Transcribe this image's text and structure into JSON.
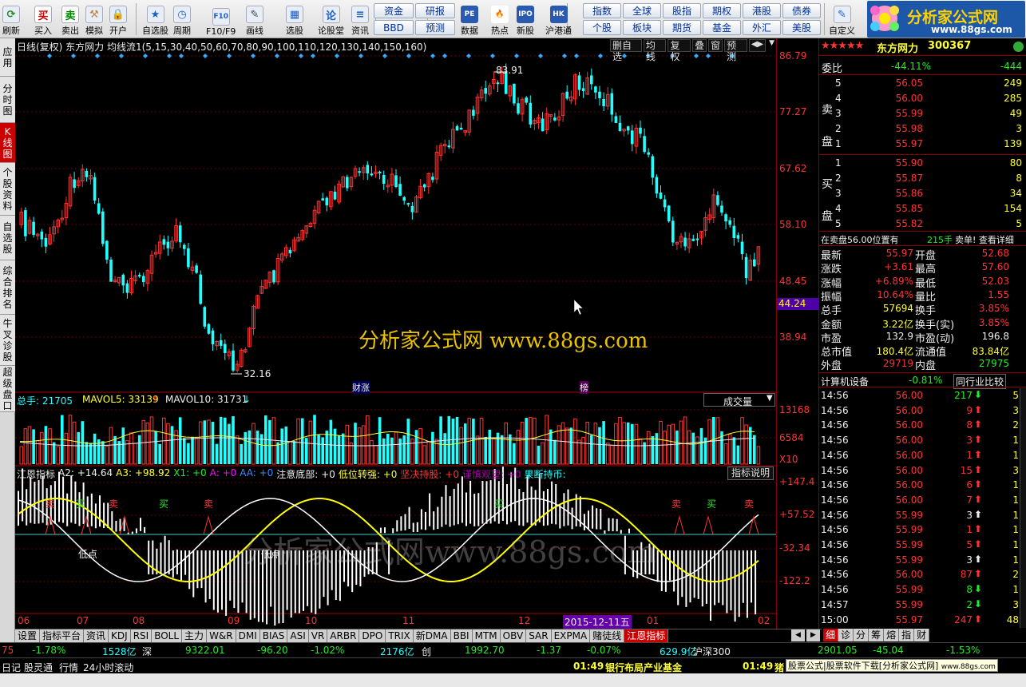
{
  "toolbar": {
    "items": [
      {
        "label": "刷新",
        "icon": "refresh-icon"
      },
      {
        "label": "买入",
        "icon": "buy-icon"
      },
      {
        "label": "卖出",
        "icon": "sell-icon"
      },
      {
        "label": "模拟",
        "icon": "gavel-icon"
      },
      {
        "label": "开户",
        "icon": "lock-icon"
      },
      {
        "label": "自选股",
        "icon": "star-icon"
      },
      {
        "label": "周期",
        "icon": "clock-icon"
      },
      {
        "label": "F10/F9",
        "icon": "f10-icon"
      },
      {
        "label": "画线",
        "icon": "pen-icon"
      },
      {
        "label": "选股",
        "icon": "screen-icon"
      },
      {
        "label": "论股堂",
        "icon": "discuss-icon"
      },
      {
        "label": "资讯",
        "icon": "news-icon"
      }
    ],
    "btn_grid": [
      [
        "资金",
        "研报"
      ],
      [
        "BBD",
        "预测"
      ]
    ],
    "items2": [
      {
        "label": "数据",
        "icon": "pe-icon"
      },
      {
        "label": "热点",
        "icon": "fire-icon"
      },
      {
        "label": "新股",
        "icon": "ipo-icon"
      },
      {
        "label": "沪港通",
        "icon": "hk-icon"
      }
    ],
    "btn_grid2": [
      [
        "指数",
        "全球",
        "股指",
        "期权",
        "港股",
        "债券"
      ],
      [
        "个股",
        "板块",
        "期货",
        "基金",
        "外汇",
        "美股"
      ]
    ],
    "custom": "自定义",
    "logo_text": "分析家公式网",
    "logo_url": "www.88gs.com"
  },
  "left_tabs": [
    "应用",
    "分时图",
    "K线图",
    "个股资料",
    "自选股",
    "综合排名",
    "牛叉诊股",
    "超级盘口"
  ],
  "chart": {
    "header": "日线(复权) 东方网力 均线流1(5,15,30,40,50,60,70,80,90,100,110,120,130,140,150,160)",
    "header_btns": [
      "删自选",
      "均线",
      "复权",
      "叠",
      "窗",
      "预测"
    ],
    "high_label": "83.91",
    "low_label": "32.16",
    "mark1": "财涨",
    "mark2": "榜",
    "watermark": "分析家公式网 www.88gs.com",
    "watermark2": "分析家公式网www.88gs.com",
    "vol_header": {
      "a": "总手: 21705",
      "b": "MAVOL5: 33139",
      "c": "MAVOL10: 31731"
    },
    "vol_select": "成交量",
    "ind_header": {
      "a": "江恩指标",
      "b": "A2: +14.64",
      "c": "A3: +98.92",
      "d": "X1: +0",
      "e": "A: +0",
      "f": "AA: +0",
      "g": "注意底部: +0",
      "h": "低位转强: +0",
      "i": "坚决持股: +0",
      "j": "谨慎观望: +0",
      "k": "果断持币:"
    },
    "ind_btn": "指标说明",
    "buy": "买",
    "sell": "卖",
    "low_pt": "低点",
    "dates": [
      "06",
      "07",
      "08",
      "09",
      "10",
      "11",
      "12",
      "01",
      "02"
    ],
    "date_hl": "2015-12-11五"
  },
  "axis": {
    "price": [
      "86.79",
      "77.27",
      "67.62",
      "58.10",
      "48.45",
      "38.94"
    ],
    "cur": "44.24",
    "vol": [
      "13168",
      "6584",
      "X10"
    ],
    "ind": [
      "+147.4",
      "+57.52",
      "-32.34",
      "-122.2"
    ]
  },
  "quote": {
    "name": "东方网力",
    "code": "300367",
    "weibi_label": "委比",
    "weibi_pct": "-44.11%",
    "weibi_val": "-444",
    "sell_label": "卖盘",
    "buy_label": "买盘",
    "asks": [
      [
        "5",
        "56.05",
        "249"
      ],
      [
        "4",
        "56.00",
        "285"
      ],
      [
        "3",
        "55.99",
        "49"
      ],
      [
        "2",
        "55.98",
        "3"
      ],
      [
        "1",
        "55.97",
        "139"
      ]
    ],
    "bids": [
      [
        "1",
        "55.90",
        "80"
      ],
      [
        "2",
        "55.87",
        "8"
      ],
      [
        "3",
        "55.86",
        "34"
      ],
      [
        "4",
        "55.85",
        "154"
      ],
      [
        "5",
        "55.82",
        "5"
      ]
    ],
    "info": {
      "a": "在卖盘56.00位置有",
      "b": "215手",
      "c": "卖单! 查看详细"
    },
    "stats": [
      [
        "最新",
        "55.97",
        "开盘",
        "52.68"
      ],
      [
        "涨跌",
        "+3.61",
        "最高",
        "57.60"
      ],
      [
        "涨幅",
        "+6.89%",
        "最低",
        "52.03"
      ],
      [
        "振幅",
        "10.64%",
        "量比",
        "1.55"
      ],
      [
        "总手",
        "57694",
        "换手",
        "3.85%"
      ],
      [
        "金额",
        "3.22亿",
        "换手(实)",
        "3.85%"
      ],
      [
        "市盈",
        "132.9",
        "市盈(动)",
        "196.8"
      ],
      [
        "总市值",
        "180.4亿",
        "流通值",
        "83.84亿"
      ],
      [
        "外盘",
        "29719",
        "内盘",
        "27975"
      ]
    ],
    "industry": "计算机设备",
    "industry_pct": "-0.81%",
    "compare": "同行业比较",
    "ticks": [
      [
        "14:56",
        "56.00",
        "217",
        "5"
      ],
      [
        "14:56",
        "56.00",
        "9",
        "3"
      ],
      [
        "14:56",
        "56.00",
        "8",
        "2"
      ],
      [
        "14:56",
        "56.00",
        "3",
        "1"
      ],
      [
        "14:56",
        "56.00",
        "1",
        "1"
      ],
      [
        "14:56",
        "56.00",
        "15",
        "3"
      ],
      [
        "14:56",
        "56.00",
        "6",
        "1"
      ],
      [
        "14:56",
        "56.00",
        "7",
        "1"
      ],
      [
        "14:56",
        "55.99",
        "3",
        "1"
      ],
      [
        "14:56",
        "55.99",
        "1",
        "1"
      ],
      [
        "14:56",
        "55.99",
        "5",
        "1"
      ],
      [
        "14:56",
        "55.99",
        "3",
        "1"
      ],
      [
        "14:56",
        "56.00",
        "87",
        "2"
      ],
      [
        "14:56",
        "55.99",
        "8",
        "1"
      ],
      [
        "14:57",
        "55.99",
        "2",
        "3"
      ],
      [
        "15:00",
        "55.97",
        "247",
        "48"
      ]
    ]
  },
  "ind_tabs": [
    "设置",
    "指标平台",
    "资讯",
    "KDJ",
    "RSI",
    "BOLL",
    "主力",
    "W&R",
    "DMI",
    "BIAS",
    "ASI",
    "VR",
    "ARBR",
    "DPO",
    "TRIX",
    "新DMA",
    "BBI",
    "MTM",
    "OBV",
    "SAR",
    "EXPMA",
    "赌徒线",
    "江恩指标"
  ],
  "right_tabs": [
    "细",
    "诊",
    "分",
    "筹",
    "熔",
    "指",
    "财"
  ],
  "status1": {
    "a": "75",
    "b": "-1.78%",
    "c": "1528亿",
    "d": "深",
    "e": "9322.01",
    "f": "-96.20",
    "g": "-1.02%",
    "h": "2176亿",
    "i": "创",
    "j": "1992.70",
    "k": "-1.37",
    "l": "-0.07%",
    "m": "629.9亿",
    "n": "沪深300",
    "o": "2901.05",
    "p": "-45.04",
    "q": "-1.53%"
  },
  "status2": {
    "a": "日记",
    "b": "股灵通",
    "c": "行情",
    "d": "24小时滚动",
    "e": "01:49",
    "f": "银行布局产业基金",
    "g": "01:49",
    "h": "猪",
    "i": "股票公式|股票软件下载[分析家公式网]",
    "j": "www.88gs.com"
  },
  "colors": {
    "up": "#f33",
    "down": "#2ff",
    "ma": "#ffff44",
    "wave": "#ffffff"
  },
  "chart_data": {
    "type": "candlestick",
    "price_ylim": [
      29,
      88
    ],
    "ind_ylim": [
      -160,
      170
    ]
  }
}
